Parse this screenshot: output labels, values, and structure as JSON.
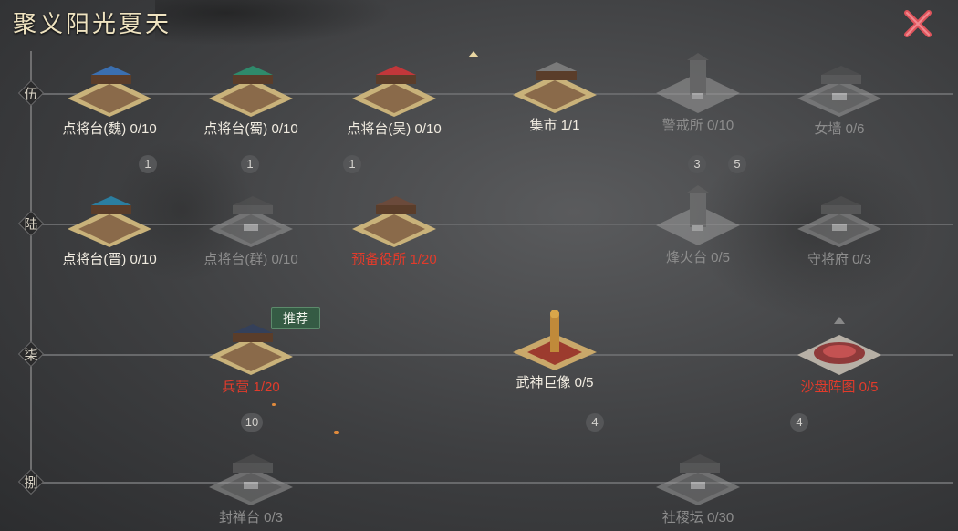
{
  "title": "聚义阳光夏天",
  "close_icon": "close-x-icon",
  "colors": {
    "accent_red": "#e23b2b",
    "close_red": "#e0545c",
    "tag_green": "#355b44"
  },
  "rows": [
    {
      "label": "伍"
    },
    {
      "label": "陆"
    },
    {
      "label": "柒"
    },
    {
      "label": "捌"
    }
  ],
  "buildings": [
    {
      "name": "点将台(魏)",
      "count": "0/10",
      "state": "normal",
      "roof": "#3b6fb0"
    },
    {
      "name": "点将台(蜀)",
      "count": "0/10",
      "state": "normal",
      "roof": "#2f8a6b"
    },
    {
      "name": "点将台(吴)",
      "count": "0/10",
      "state": "normal",
      "roof": "#c2373a"
    },
    {
      "name": "集市",
      "count": "1/1",
      "state": "normal",
      "roof": "#7a7a7a"
    },
    {
      "name": "警戒所",
      "count": "0/10",
      "state": "locked",
      "roof": "#555"
    },
    {
      "name": "女墙",
      "count": "0/6",
      "state": "locked",
      "roof": "#555"
    },
    {
      "name": "点将台(晋)",
      "count": "0/10",
      "state": "normal",
      "roof": "#2b7ea0"
    },
    {
      "name": "点将台(群)",
      "count": "0/10",
      "state": "locked",
      "roof": "#555"
    },
    {
      "name": "预备役所",
      "count": "1/20",
      "state": "red",
      "roof": "#6b4a3b"
    },
    {
      "name": "烽火台",
      "count": "0/5",
      "state": "locked",
      "roof": "#555"
    },
    {
      "name": "守将府",
      "count": "0/3",
      "state": "locked",
      "roof": "#555"
    },
    {
      "name": "兵营",
      "count": "1/20",
      "state": "red",
      "roof": "#34405a"
    },
    {
      "name": "武神巨像",
      "count": "0/5",
      "state": "normal",
      "roof": "#c08a3a"
    },
    {
      "name": "沙盘阵图",
      "count": "0/5",
      "state": "red",
      "roof": "#9a3b3b"
    },
    {
      "name": "封禅台",
      "count": "0/3",
      "state": "locked",
      "roof": "#555"
    },
    {
      "name": "社稷坛",
      "count": "0/30",
      "state": "locked",
      "roof": "#555"
    }
  ],
  "badges": [
    "1",
    "1",
    "1",
    "3",
    "5",
    "10",
    "4",
    "4"
  ],
  "recommend_tag": "推荐"
}
